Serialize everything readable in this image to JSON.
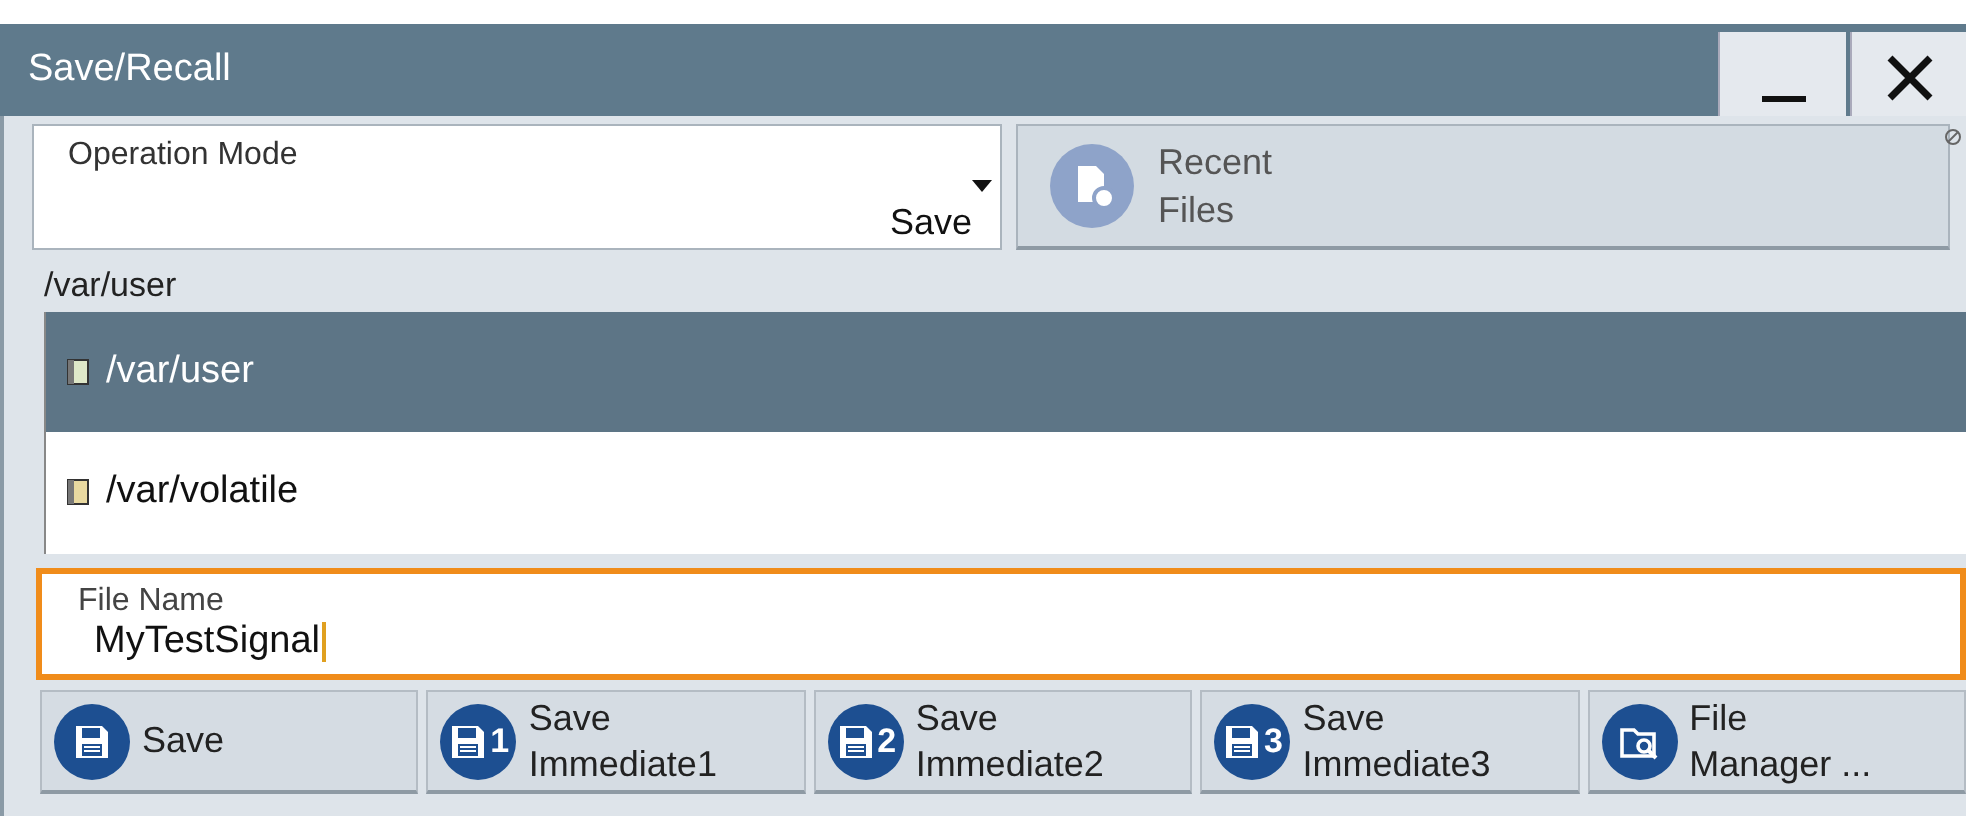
{
  "window": {
    "title": "Save/Recall"
  },
  "operation_mode": {
    "label": "Operation Mode",
    "value": "Save"
  },
  "recent_files": {
    "label_line1": "Recent",
    "label_line2": "Files"
  },
  "path": "/var/user",
  "directories": [
    {
      "name": "/var/user",
      "selected": true
    },
    {
      "name": "/var/volatile",
      "selected": false
    }
  ],
  "file_name": {
    "label": "File Name",
    "value": "MyTestSignal",
    "focused": true
  },
  "buttons": [
    {
      "kind": "save",
      "line1": "Save"
    },
    {
      "kind": "immediate",
      "digit": "1",
      "line1": "Save",
      "line2": "Immediate1"
    },
    {
      "kind": "immediate",
      "digit": "2",
      "line1": "Save",
      "line2": "Immediate2"
    },
    {
      "kind": "immediate",
      "digit": "3",
      "line1": "Save",
      "line2": "Immediate3"
    },
    {
      "kind": "manager",
      "line1": "File",
      "line2": "Manager ..."
    }
  ]
}
